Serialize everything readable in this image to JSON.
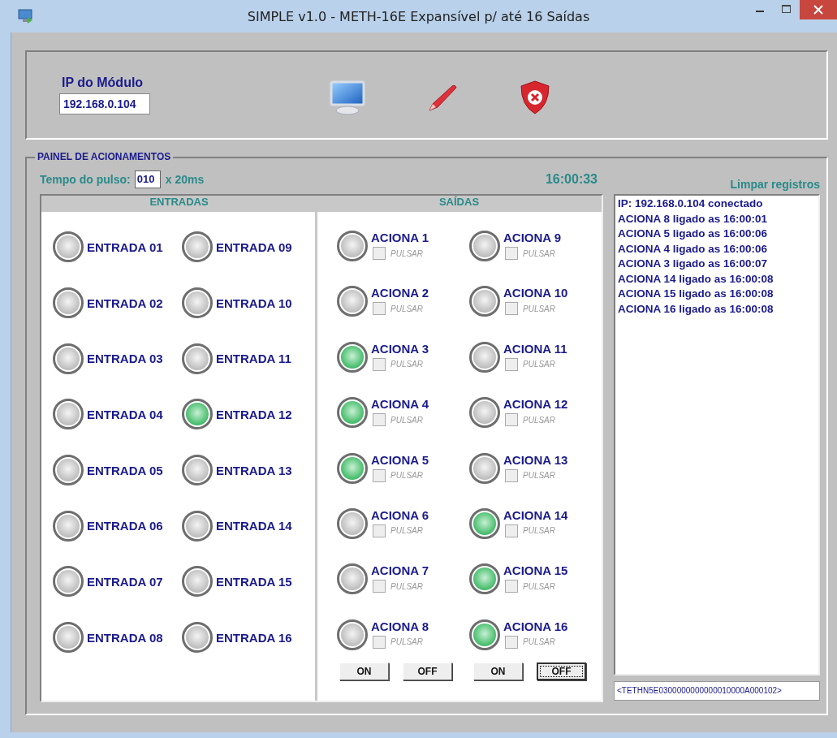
{
  "window": {
    "title": "SIMPLE v1.0 - METH-16E Expansível p/ até 16 Saídas"
  },
  "module": {
    "label": "IP do Módulo",
    "ip": "192.168.0.104"
  },
  "panel": {
    "title": "PAINEL DE ACIONAMENTOS",
    "pulse_label": "Tempo do pulso:",
    "pulse_value": "010",
    "pulse_unit": "x 20ms",
    "clock": "16:00:33",
    "clear_log": "Limpar registros",
    "inputs_heading": "ENTRADAS",
    "outputs_heading": "SAÍDAS"
  },
  "inputs": [
    {
      "label": "ENTRADA 01",
      "on": false
    },
    {
      "label": "ENTRADA 02",
      "on": false
    },
    {
      "label": "ENTRADA 03",
      "on": false
    },
    {
      "label": "ENTRADA 04",
      "on": false
    },
    {
      "label": "ENTRADA 05",
      "on": false
    },
    {
      "label": "ENTRADA 06",
      "on": false
    },
    {
      "label": "ENTRADA 07",
      "on": false
    },
    {
      "label": "ENTRADA 08",
      "on": false
    },
    {
      "label": "ENTRADA 09",
      "on": false
    },
    {
      "label": "ENTRADA 10",
      "on": false
    },
    {
      "label": "ENTRADA 11",
      "on": false
    },
    {
      "label": "ENTRADA 12",
      "on": true
    },
    {
      "label": "ENTRADA 13",
      "on": false
    },
    {
      "label": "ENTRADA 14",
      "on": false
    },
    {
      "label": "ENTRADA 15",
      "on": false
    },
    {
      "label": "ENTRADA 16",
      "on": false
    }
  ],
  "outputs": [
    {
      "label": "ACIONA 1",
      "on": false,
      "pulse": "PULSAR",
      "checked": false
    },
    {
      "label": "ACIONA 2",
      "on": false,
      "pulse": "PULSAR",
      "checked": false
    },
    {
      "label": "ACIONA 3",
      "on": true,
      "pulse": "PULSAR",
      "checked": false
    },
    {
      "label": "ACIONA 4",
      "on": true,
      "pulse": "PULSAR",
      "checked": false
    },
    {
      "label": "ACIONA 5",
      "on": true,
      "pulse": "PULSAR",
      "checked": false
    },
    {
      "label": "ACIONA 6",
      "on": false,
      "pulse": "PULSAR",
      "checked": false
    },
    {
      "label": "ACIONA 7",
      "on": false,
      "pulse": "PULSAR",
      "checked": false
    },
    {
      "label": "ACIONA 8",
      "on": false,
      "pulse": "PULSAR",
      "checked": false
    },
    {
      "label": "ACIONA 9",
      "on": false,
      "pulse": "PULSAR",
      "checked": false
    },
    {
      "label": "ACIONA 10",
      "on": false,
      "pulse": "PULSAR",
      "checked": false
    },
    {
      "label": "ACIONA 11",
      "on": false,
      "pulse": "PULSAR",
      "checked": false
    },
    {
      "label": "ACIONA 12",
      "on": false,
      "pulse": "PULSAR",
      "checked": false
    },
    {
      "label": "ACIONA 13",
      "on": false,
      "pulse": "PULSAR",
      "checked": false
    },
    {
      "label": "ACIONA 14",
      "on": true,
      "pulse": "PULSAR",
      "checked": false
    },
    {
      "label": "ACIONA 15",
      "on": true,
      "pulse": "PULSAR",
      "checked": false
    },
    {
      "label": "ACIONA 16",
      "on": true,
      "pulse": "PULSAR",
      "checked": false
    }
  ],
  "buttons": [
    {
      "label": "ON",
      "focused": false
    },
    {
      "label": "OFF",
      "focused": false
    },
    {
      "label": "ON",
      "focused": false
    },
    {
      "label": "OFF",
      "focused": true
    }
  ],
  "log": [
    "IP: 192.168.0.104 conectado",
    "ACIONA 8 ligado as 16:00:01",
    "ACIONA 5 ligado as 16:00:06",
    "ACIONA 4 ligado as 16:00:06",
    "ACIONA 3 ligado as 16:00:07",
    "ACIONA 14 ligado as 16:00:08",
    "ACIONA 15 ligado as 16:00:08",
    "ACIONA 16 ligado as 16:00:08"
  ],
  "command": "<TETHN5E0300000000000010000A000102>"
}
